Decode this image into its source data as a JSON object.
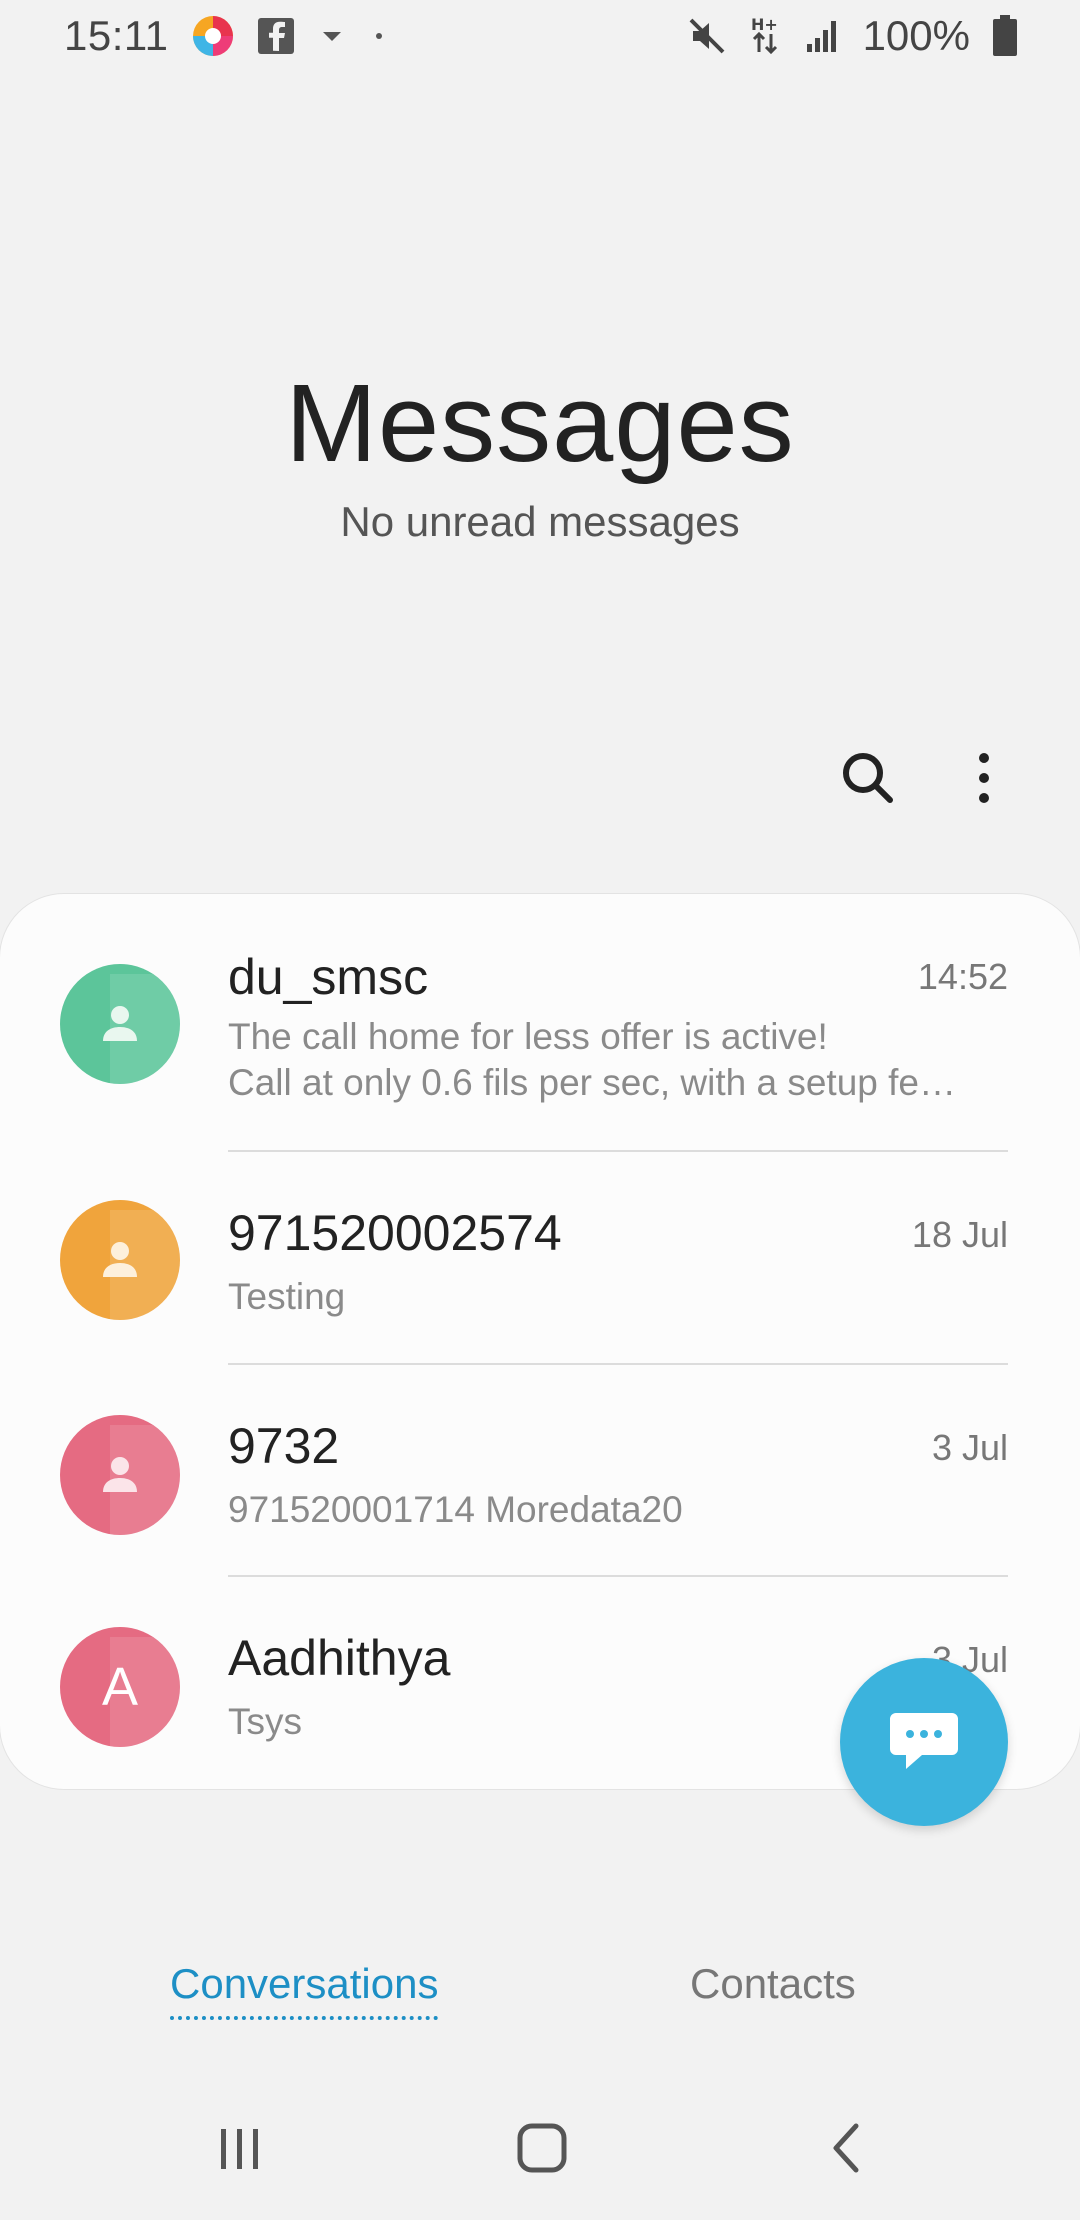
{
  "status_bar": {
    "time": "15:11",
    "battery_pct": "100%",
    "left_icons": [
      "app-circle-icon",
      "facebook-icon",
      "dropdown-arrow-icon",
      "dot-icon"
    ],
    "right_icons": [
      "mute-icon",
      "hplus-data-icon",
      "signal-icon",
      "battery-icon"
    ]
  },
  "header": {
    "title": "Messages",
    "subtitle": "No unread messages"
  },
  "toolbar": {
    "icons": [
      "search-icon",
      "more-vert-icon"
    ]
  },
  "conversations": [
    {
      "name": "du_smsc",
      "date": "14:52",
      "preview_line1": "The call home for less offer is active!",
      "preview_line2": "Call at only 0.6 fils per sec, with a setup fe…",
      "avatar_color": "#5cc59a",
      "avatar_type": "person-icon"
    },
    {
      "name": "971520002574",
      "date": "18 Jul",
      "preview_line1": "Testing",
      "avatar_color": "#f0a43c",
      "avatar_type": "person-icon"
    },
    {
      "name": "9732",
      "date": "3 Jul",
      "preview_line1": "971520001714 Moredata20",
      "avatar_color": "#e56b82",
      "avatar_type": "person-icon"
    },
    {
      "name": "Aadhithya",
      "date": "3 Jul",
      "preview_line1": "Tsys",
      "avatar_color": "#e56b82",
      "avatar_letter": "A"
    }
  ],
  "fab": {
    "icon": "compose-chat-icon",
    "color": "#3bb3dd"
  },
  "tabs": {
    "conversations": "Conversations",
    "contacts": "Contacts",
    "active_color": "#1d8fc5"
  },
  "nav": {
    "icons": [
      "recents-icon",
      "home-icon",
      "back-icon"
    ]
  }
}
